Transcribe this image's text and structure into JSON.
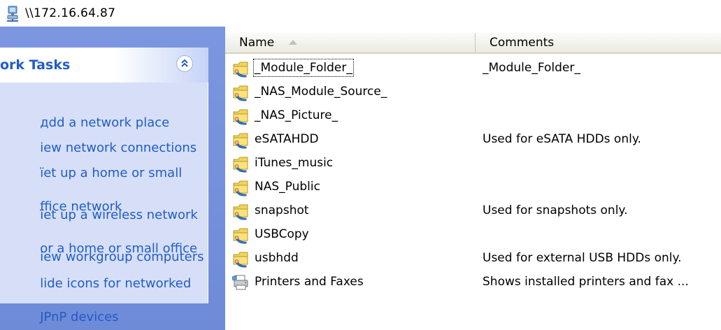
{
  "address": {
    "path": "\\\\172.16.64.87",
    "icon": "network-computer-icon"
  },
  "task_pane": {
    "title": "ork Tasks",
    "collapse_icon": "double-chevron-up-icon",
    "links": [
      {
        "line1": "дdd a network place",
        "line2": ""
      },
      {
        "line1": "iew network connections",
        "line2": ""
      },
      {
        "line1": "їet up a home or small",
        "line2": "ffice network"
      },
      {
        "line1": "їet up a wireless network",
        "line2": "or a home or small office"
      },
      {
        "line1": "iew workgroup computers",
        "line2": ""
      },
      {
        "line1": "lide icons for networked",
        "line2": "JPnP devices"
      }
    ],
    "colors": {
      "pane_bg": "#7c96e0",
      "box_bg": "#d6dff7",
      "link": "#215dc6"
    }
  },
  "columns": {
    "name": "Name",
    "comments": "Comments",
    "sort": "ascending"
  },
  "rows": [
    {
      "name": "_Module_Folder_",
      "comment": "_Module_Folder_",
      "icon": "shared-folder-icon",
      "focused": true
    },
    {
      "name": "_NAS_Module_Source_",
      "comment": "",
      "icon": "shared-folder-icon"
    },
    {
      "name": "_NAS_Picture_",
      "comment": "",
      "icon": "shared-folder-icon"
    },
    {
      "name": "eSATAHDD",
      "comment": "Used for eSATA HDDs only.",
      "icon": "shared-folder-icon"
    },
    {
      "name": "iTunes_music",
      "comment": "",
      "icon": "shared-folder-icon"
    },
    {
      "name": "NAS_Public",
      "comment": "",
      "icon": "shared-folder-icon"
    },
    {
      "name": "snapshot",
      "comment": "Used for snapshots only.",
      "icon": "shared-folder-icon"
    },
    {
      "name": "USBCopy",
      "comment": "",
      "icon": "shared-folder-icon"
    },
    {
      "name": "usbhdd",
      "comment": "Used for external USB HDDs only.",
      "icon": "shared-folder-icon"
    },
    {
      "name": "Printers and Faxes",
      "comment": "Shows installed printers and fax ...",
      "icon": "printer-icon"
    }
  ]
}
